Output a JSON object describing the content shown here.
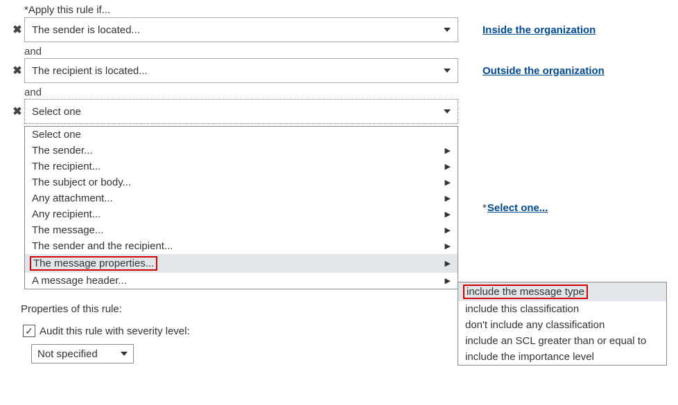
{
  "header": {
    "title": "*Apply this rule if..."
  },
  "conditions": [
    {
      "dropdown": "The sender is located...",
      "value": "Inside the organization"
    },
    {
      "dropdown": "The recipient is located...",
      "value": "Outside the organization"
    },
    {
      "dropdown": "Select one",
      "value": "Select one..."
    }
  ],
  "and_label": "and",
  "menu": {
    "items": [
      {
        "label": "Select one",
        "arrow": false
      },
      {
        "label": "The sender...",
        "arrow": true
      },
      {
        "label": "The recipient...",
        "arrow": true
      },
      {
        "label": "The subject or body...",
        "arrow": true
      },
      {
        "label": "Any attachment...",
        "arrow": true
      },
      {
        "label": "Any recipient...",
        "arrow": true
      },
      {
        "label": "The message...",
        "arrow": true
      },
      {
        "label": "The sender and the recipient...",
        "arrow": true
      },
      {
        "label": "The message properties...",
        "arrow": true,
        "hl": true,
        "boxed": true
      },
      {
        "label": "A message header...",
        "arrow": true
      }
    ]
  },
  "submenu": {
    "items": [
      {
        "label": "include the message type",
        "hl": true,
        "boxed": true
      },
      {
        "label": "include this classification"
      },
      {
        "label": "don't include any classification"
      },
      {
        "label": "include an SCL greater than or equal to"
      },
      {
        "label": "include the importance level"
      }
    ]
  },
  "properties": {
    "title": "Properties of this rule:",
    "audit": "Audit this rule with severity level:",
    "severity": "Not specified"
  }
}
